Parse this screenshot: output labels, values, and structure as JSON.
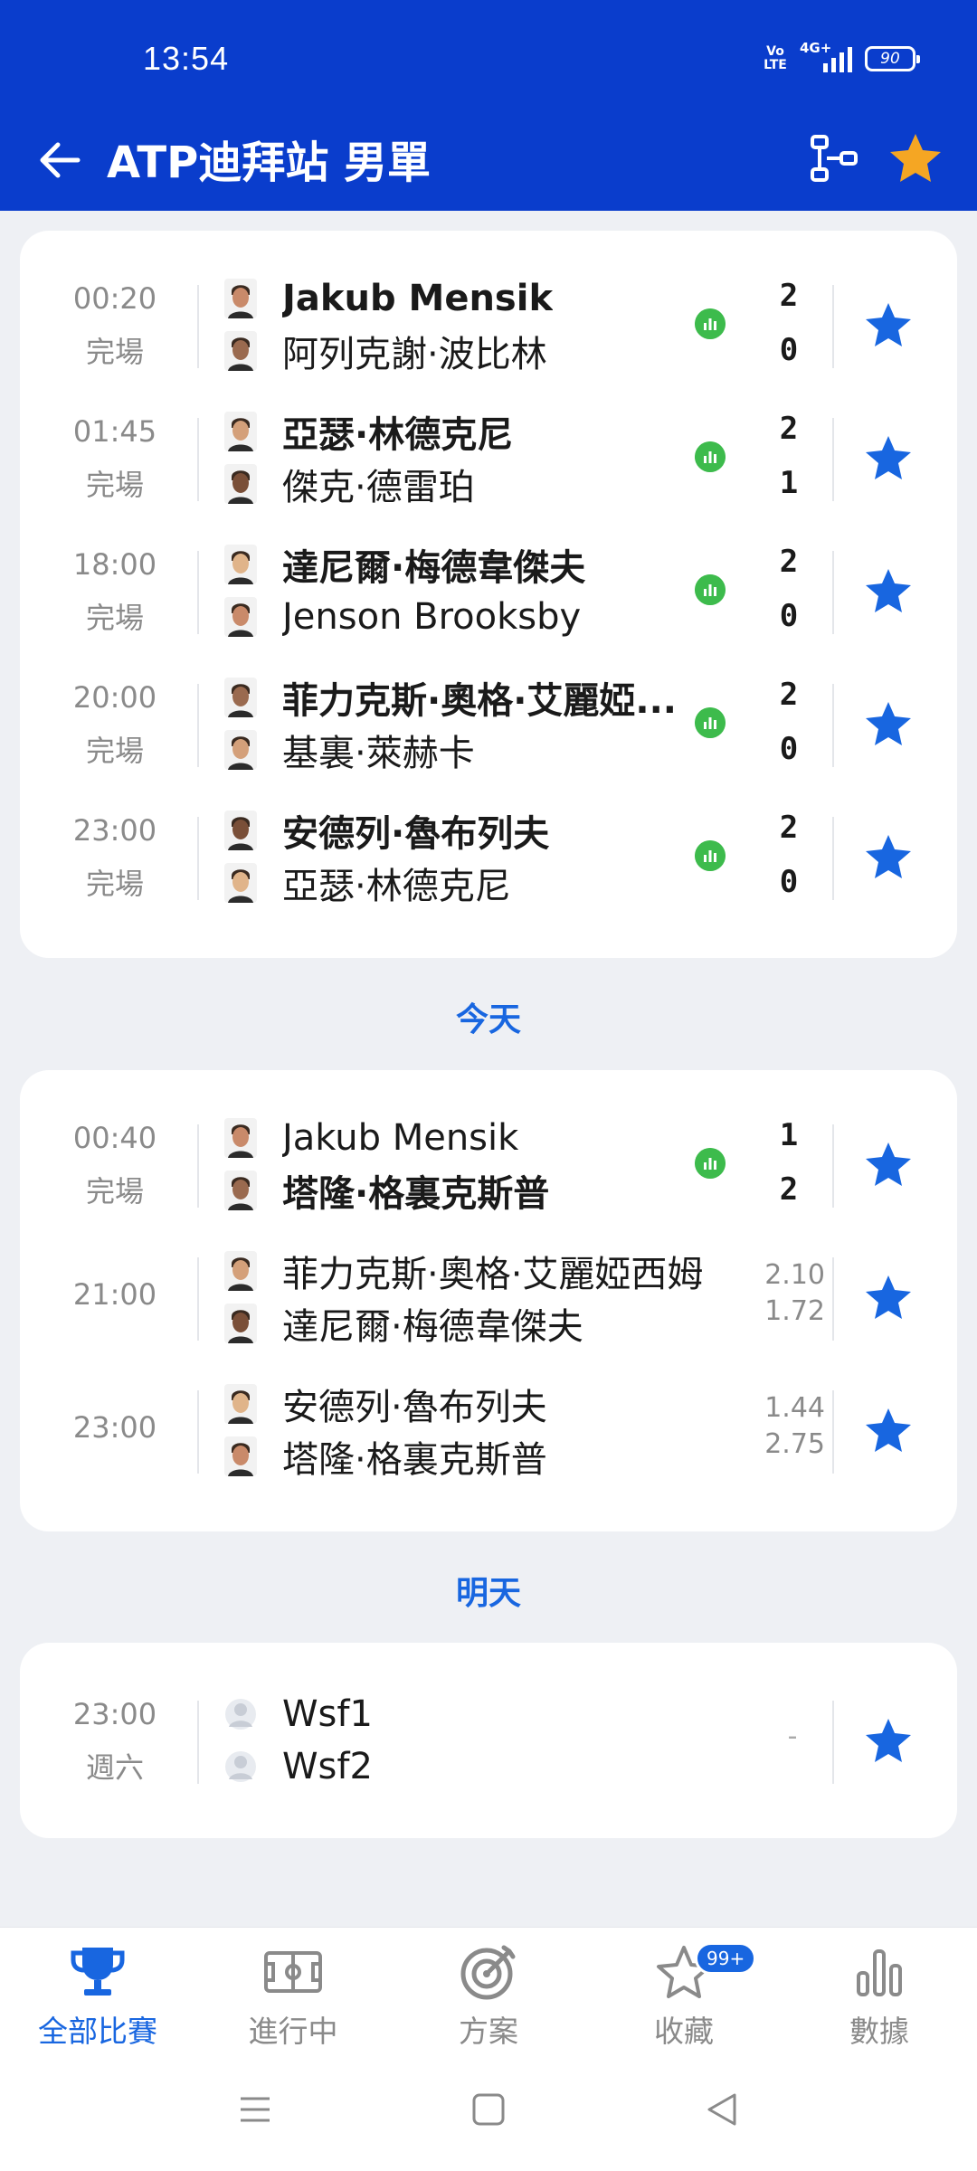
{
  "status_bar": {
    "time": "13:54",
    "volte": "Vo LTE",
    "network": "4G+",
    "battery": "90"
  },
  "app_bar": {
    "title": "ATP迪拜站 男單"
  },
  "colors": {
    "primary": "#0a3dcc",
    "accent": "#1866e0",
    "star": "#f5a623",
    "live_stat": "#3dbb4c"
  },
  "past_matches": [
    {
      "time": "00:20",
      "status": "完場",
      "p1": "Jakub Mensik",
      "p2": "阿列克謝·波比林",
      "s1": "2",
      "s2": "0",
      "winner": 1
    },
    {
      "time": "01:45",
      "status": "完場",
      "p1": "亞瑟·林德克尼",
      "p2": "傑克·德雷珀",
      "s1": "2",
      "s2": "1",
      "winner": 1
    },
    {
      "time": "18:00",
      "status": "完場",
      "p1": "達尼爾·梅德韋傑夫",
      "p2": "Jenson Brooksby",
      "s1": "2",
      "s2": "0",
      "winner": 1
    },
    {
      "time": "20:00",
      "status": "完場",
      "p1": "菲力克斯·奧格·艾麗婭...",
      "p2": "基裏·萊赫卡",
      "s1": "2",
      "s2": "0",
      "winner": 1
    },
    {
      "time": "23:00",
      "status": "完場",
      "p1": "安德列·魯布列夫",
      "p2": "亞瑟·林德克尼",
      "s1": "2",
      "s2": "0",
      "winner": 1
    }
  ],
  "today_label": "今天",
  "today_matches": [
    {
      "time": "00:40",
      "status": "完場",
      "p1": "Jakub Mensik",
      "p2": "塔隆·格裏克斯普",
      "s1": "1",
      "s2": "2",
      "winner": 2
    },
    {
      "time": "21:00",
      "p1": "菲力克斯·奧格·艾麗婭西姆",
      "p2": "達尼爾·梅德韋傑夫",
      "odds1": "2.10",
      "odds2": "1.72"
    },
    {
      "time": "23:00",
      "p1": "安德列·魯布列夫",
      "p2": "塔隆·格裏克斯普",
      "odds1": "1.44",
      "odds2": "2.75"
    }
  ],
  "tomorrow_label": "明天",
  "tomorrow_matches": [
    {
      "time": "23:00",
      "status": "週六",
      "p1": "Wsf1",
      "p2": "Wsf2",
      "score": "-"
    }
  ],
  "bottom_nav": [
    {
      "label": "全部比賽",
      "icon": "trophy-icon",
      "active": true
    },
    {
      "label": "進行中",
      "icon": "pitch-icon",
      "active": false
    },
    {
      "label": "方案",
      "icon": "target-icon",
      "active": false
    },
    {
      "label": "收藏",
      "icon": "star-outline-icon",
      "active": false,
      "badge": "99+"
    },
    {
      "label": "數據",
      "icon": "bar-chart-icon",
      "active": false
    }
  ]
}
